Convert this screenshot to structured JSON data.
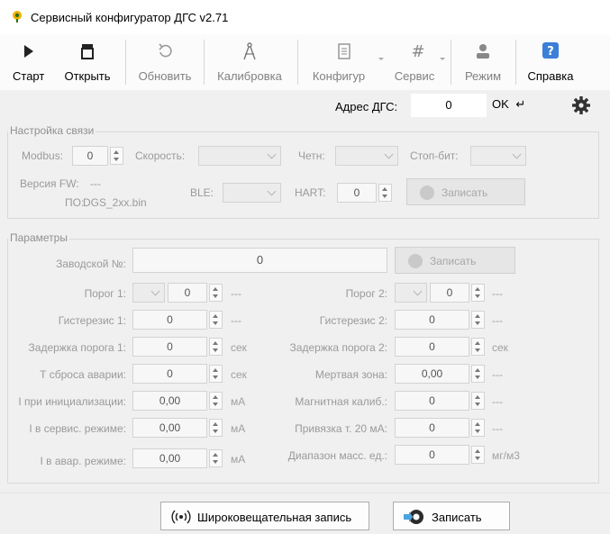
{
  "window": {
    "title": "Сервисный конфигуратор ДГС v2.71"
  },
  "toolbar": {
    "start": "Старт",
    "open": "Открыть",
    "refresh": "Обновить",
    "calibration": "Калибровка",
    "config": "Конфигур",
    "service": "Сервис",
    "mode": "Режим",
    "help": "Справка"
  },
  "address": {
    "label": "Адрес ДГС:",
    "value": "0",
    "ok": "OK"
  },
  "comm": {
    "title": "Настройка связи",
    "modbus_label": "Modbus:",
    "modbus_value": "0",
    "speed_label": "Скорость:",
    "parity_label": "Четн:",
    "stopbit_label": "Стоп-бит:",
    "fw_label": "Версия FW:",
    "fw_value": "---",
    "po_label": "ПО:",
    "po_value": "DGS_2xx.bin",
    "ble_label": "BLE:",
    "hart_label": "HART:",
    "hart_value": "0",
    "write": "Записать"
  },
  "params": {
    "title": "Параметры",
    "serial_label": "Заводской №:",
    "serial_value": "0",
    "write": "Записать",
    "threshold1_label": "Порог 1:",
    "threshold1_value": "0",
    "threshold1_unit": "---",
    "threshold2_label": "Порог 2:",
    "threshold2_value": "0",
    "threshold2_unit": "---",
    "hyst1_label": "Гистерезис 1:",
    "hyst1_value": "0",
    "hyst1_unit": "---",
    "hyst2_label": "Гистерезис 2:",
    "hyst2_value": "0",
    "hyst2_unit": "---",
    "delay1_label": "Задержка порога 1:",
    "delay1_value": "0",
    "delay1_unit": "сек",
    "delay2_label": "Задержка порога 2:",
    "delay2_value": "0",
    "delay2_unit": "сек",
    "reset_label": "Т сброса аварии:",
    "reset_value": "0",
    "reset_unit": "сек",
    "deadzone_label": "Мертвая зона:",
    "deadzone_value": "0,00",
    "deadzone_unit": "---",
    "iinit_label": "I при инициализации:",
    "iinit_value": "0,00",
    "iinit_unit": "мА",
    "magcal_label": "Магнитная калиб.:",
    "magcal_value": "0",
    "magcal_unit": "---",
    "iservice_label": "I в сервис. режиме:",
    "iservice_value": "0,00",
    "iservice_unit": "мА",
    "bind20_label": "Привязка т. 20 мА:",
    "bind20_value": "0",
    "bind20_unit": "---",
    "ialarm_label": "I в авар. режиме:",
    "ialarm_value": "0,00",
    "ialarm_unit": "мА",
    "range_label": "Диапазон масс. ед.:",
    "range_value": "0",
    "range_unit": "мг/м3"
  },
  "footer": {
    "broadcast": "Широковещательная запись",
    "write": "Записать"
  },
  "colors": {
    "accent_blue": "#1a5fb4",
    "title_bar": "#ffffff",
    "window_bg": "#f0f0f0"
  }
}
